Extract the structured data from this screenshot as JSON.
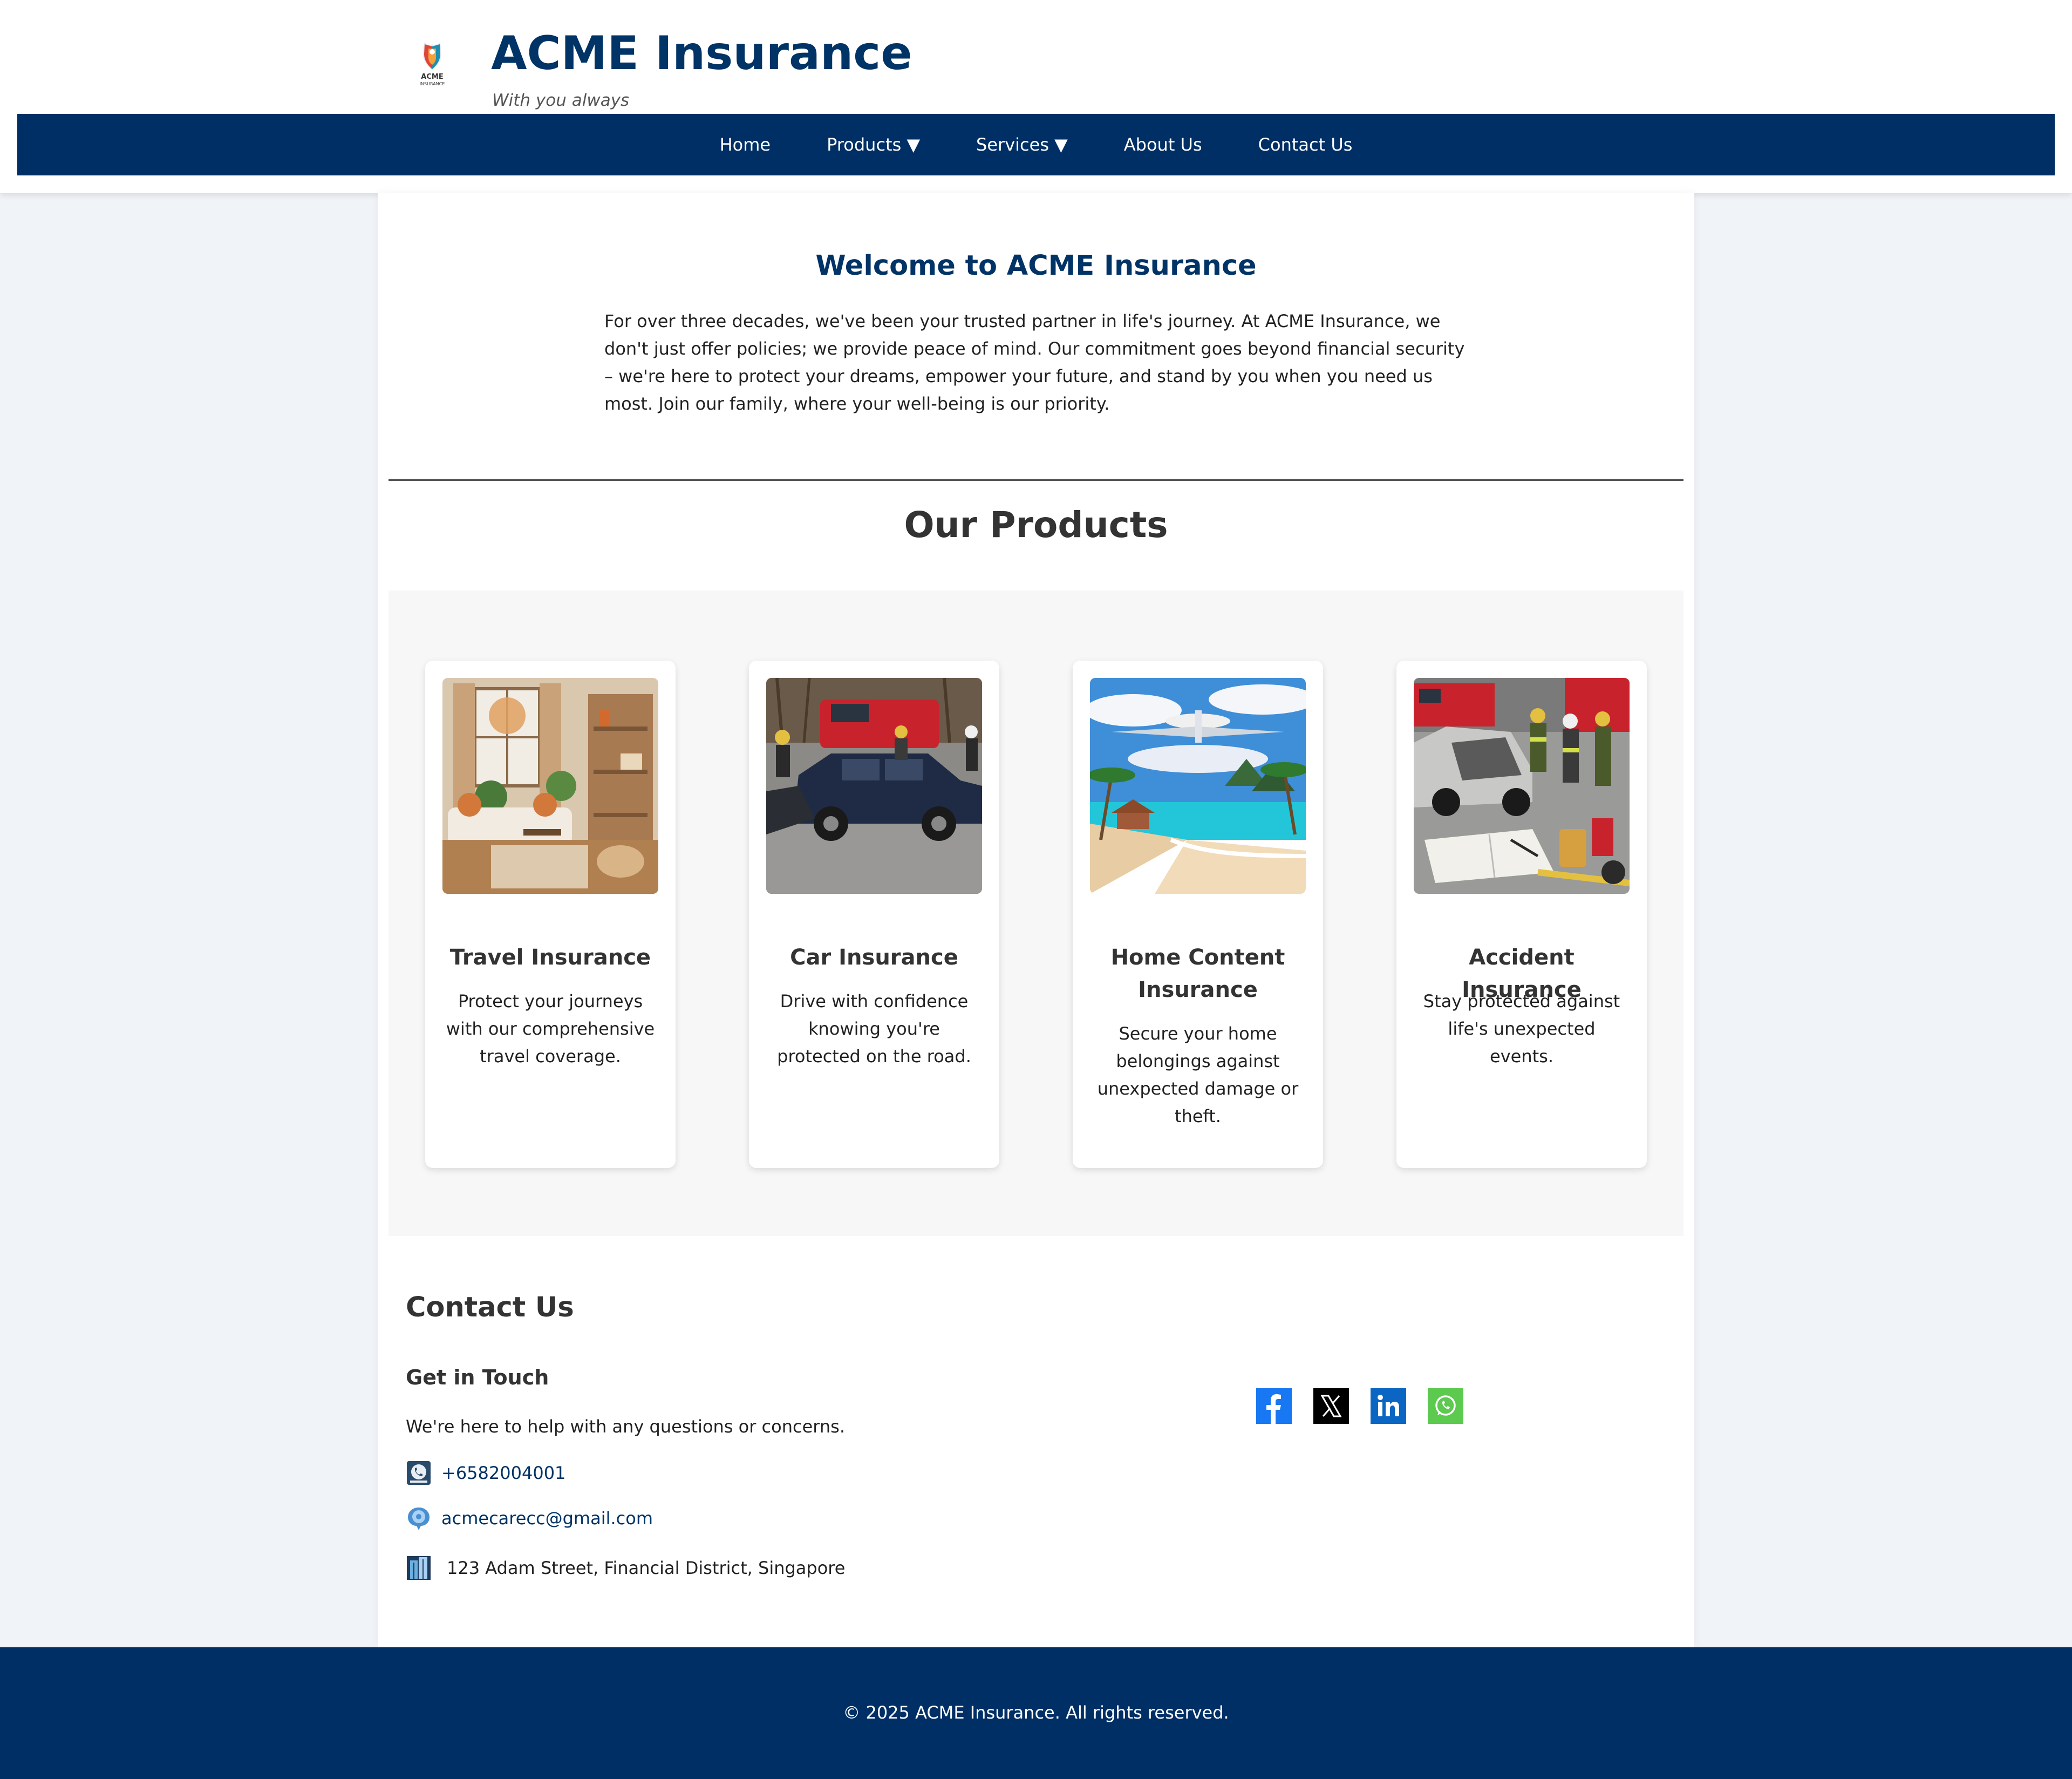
{
  "header": {
    "logo_text": "ACME",
    "logo_subtext": "INSURANCE",
    "title": "ACME Insurance",
    "tagline": "With you always"
  },
  "nav": {
    "items": [
      "Home",
      "Products ▼",
      "Services ▼",
      "About Us",
      "Contact Us"
    ]
  },
  "welcome": {
    "title": "Welcome to ACME Insurance",
    "text": "For over three decades, we've been your trusted partner in life's journey. At ACME Insurance, we don't just offer policies; we provide peace of mind. Our commitment goes beyond financial security – we're here to protect your dreams, empower your future, and stand by you when you need us most. Join our family, where your well-being is our priority."
  },
  "products": {
    "title": "Our Products",
    "items": [
      {
        "title": "Travel Insurance",
        "description": "Protect your journeys with our comprehensive travel coverage.",
        "image": "living-room-image"
      },
      {
        "title": "Car Insurance",
        "description": "Drive with confidence knowing you're protected on the road.",
        "image": "car-accident-image"
      },
      {
        "title": "Home Content Insurance",
        "description": "Secure your home belongings against unexpected damage or theft.",
        "image": "airplane-beach-image"
      },
      {
        "title": "Accident Insurance",
        "description": "Stay protected against life's unexpected events.",
        "image": "accident-scene-image"
      }
    ]
  },
  "contact": {
    "title": "Contact Us",
    "subtitle": "Get in Touch",
    "text": "We're here to help with any questions or concerns.",
    "phone": "+6582004001",
    "email": "acmecarecc@gmail.com",
    "address": "123 Adam Street, Financial District, Singapore",
    "social": [
      "facebook-icon",
      "x-icon",
      "linkedin-icon",
      "whatsapp-icon"
    ]
  },
  "footer": {
    "text": "© 2025 ACME Insurance. All rights reserved."
  },
  "colors": {
    "brand": "#003366",
    "nav": "#002f65",
    "background": "#f0f3f7"
  }
}
